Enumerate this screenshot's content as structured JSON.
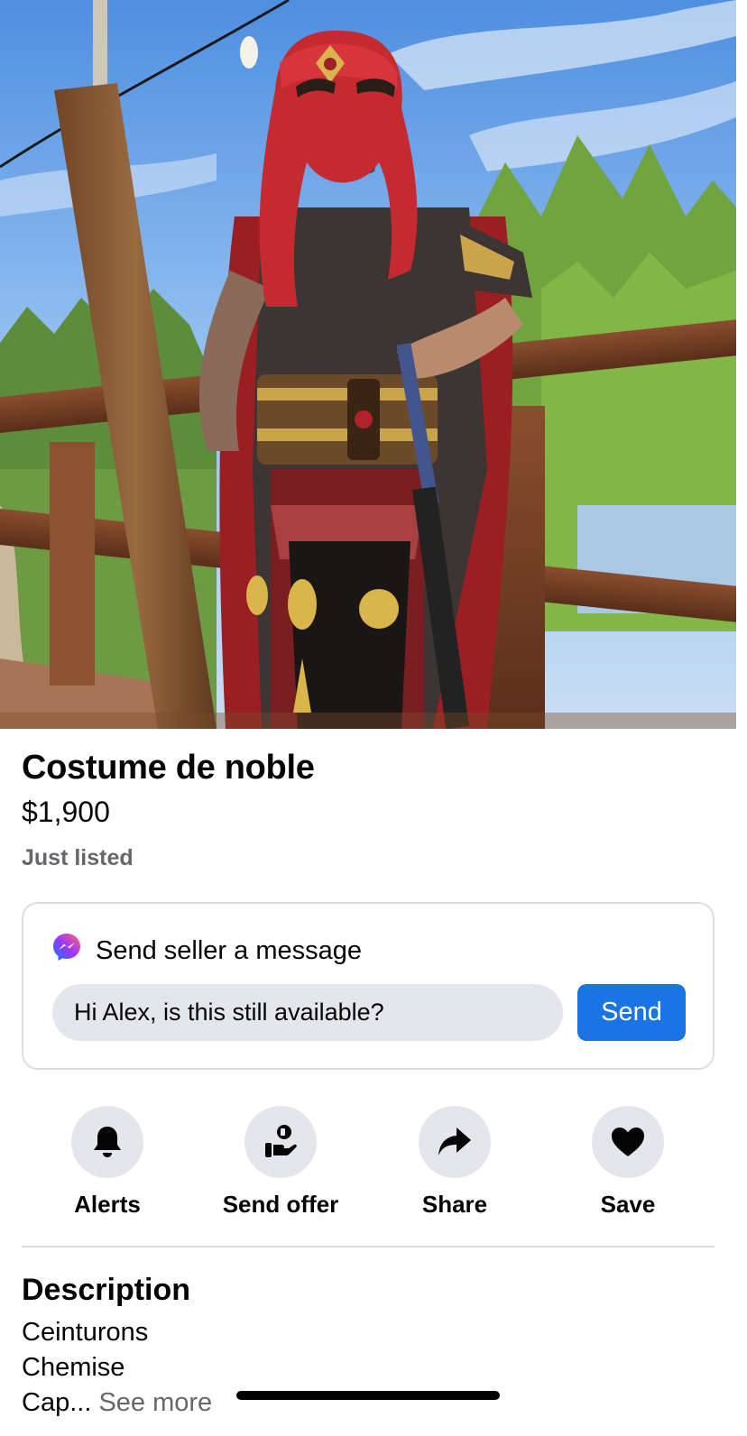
{
  "listing": {
    "title": "Costume de noble",
    "price": "$1,900",
    "status": "Just listed"
  },
  "message": {
    "heading": "Send seller a message",
    "input_value": "Hi Alex, is this still available?",
    "send_label": "Send",
    "icon": "messenger-icon"
  },
  "actions": [
    {
      "label": "Alerts",
      "icon": "bell-icon"
    },
    {
      "label": "Send offer",
      "icon": "send-offer-icon"
    },
    {
      "label": "Share",
      "icon": "share-arrow-icon"
    },
    {
      "label": "Save",
      "icon": "heart-icon"
    }
  ],
  "description": {
    "heading": "Description",
    "lines": [
      "Ceinturons",
      "Chemise",
      "Cap..."
    ],
    "see_more": "See more"
  },
  "colors": {
    "accent": "#1b74e4",
    "secondary_text": "#65676b",
    "chip_background": "#e4e6eb"
  }
}
